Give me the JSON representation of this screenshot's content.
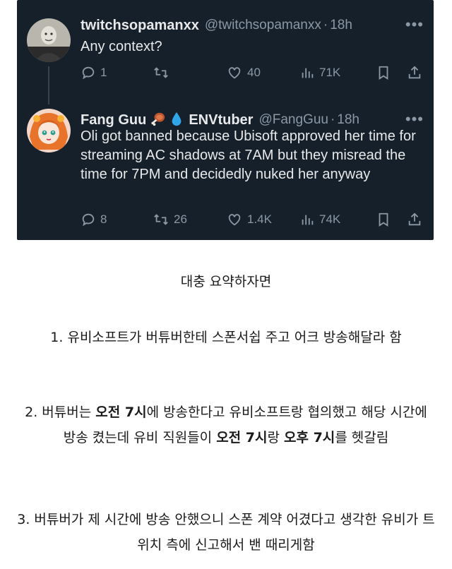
{
  "tweets": [
    {
      "display_name": "twitchsopamanxx",
      "handle": "@twitchsopamanxx",
      "time": "18h",
      "text": "Any context?",
      "replies": "1",
      "retweets": "",
      "likes": "40",
      "views": "71K"
    },
    {
      "display_name": "Fang Guu",
      "name_suffix": "ENVtuber",
      "handle": "@FangGuu",
      "time": "18h",
      "text": "Oli got banned because Ubisoft approved her time for streaming AC shadows at 7AM but they misread the time for 7PM and decidedly nuked her anyway",
      "replies": "8",
      "retweets": "26",
      "likes": "1.4K",
      "views": "74K"
    }
  ],
  "caption": {
    "heading": "대충 요약하자면",
    "p1": "1. 유비소프트가 버튜버한테 스폰서쉽 주고 어크 방송해달라 함",
    "p2": {
      "a": "2. 버튜버는 ",
      "b": "오전 7시",
      "c": "에 방송한다고 유비소프트랑 협의했고 해당 시간에 방송 켰는데 유비 직원들이 ",
      "d": "오전 7시",
      "e": "랑 ",
      "f": "오후 7시",
      "g": "를 헷갈림"
    },
    "p3": "3. 버튜버가 제 시간에 방송 안했으니 스폰 계약 어겼다고 생각한 유비가 트위치 측에 신고해서 밴 때리게함"
  }
}
